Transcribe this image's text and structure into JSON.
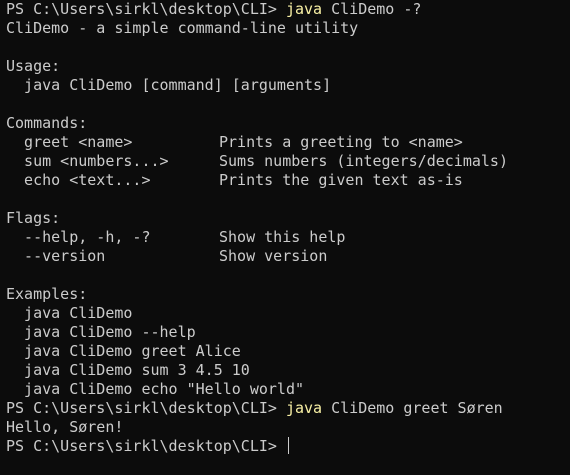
{
  "prompt": "PS C:\\Users\\sirkl\\desktop\\CLI> ",
  "session1": {
    "command": "java",
    "args": "CliDemo -?"
  },
  "help": {
    "title": "CliDemo - a simple command-line utility",
    "usage_heading": "Usage:",
    "usage_line": "  java CliDemo [command] [arguments]",
    "commands_heading": "Commands:",
    "commands": [
      {
        "name": "  greet <name>",
        "desc": "Prints a greeting to <name>"
      },
      {
        "name": "  sum <numbers...>",
        "desc": "Sums numbers (integers/decimals)"
      },
      {
        "name": "  echo <text...>",
        "desc": "Prints the given text as-is"
      }
    ],
    "flags_heading": "Flags:",
    "flags": [
      {
        "name": "  --help, -h, -?",
        "desc": "Show this help"
      },
      {
        "name": "  --version",
        "desc": "Show version"
      }
    ],
    "examples_heading": "Examples:",
    "examples": [
      "  java CliDemo",
      "  java CliDemo --help",
      "  java CliDemo greet Alice",
      "  java CliDemo sum 3 4.5 10",
      "  java CliDemo echo \"Hello world\""
    ]
  },
  "session2": {
    "command": "java",
    "args": "CliDemo greet Søren",
    "output": "Hello, Søren!"
  },
  "colors": {
    "background": "#0c0c0c",
    "text": "#cccccc",
    "command": "#f9f1a5"
  }
}
